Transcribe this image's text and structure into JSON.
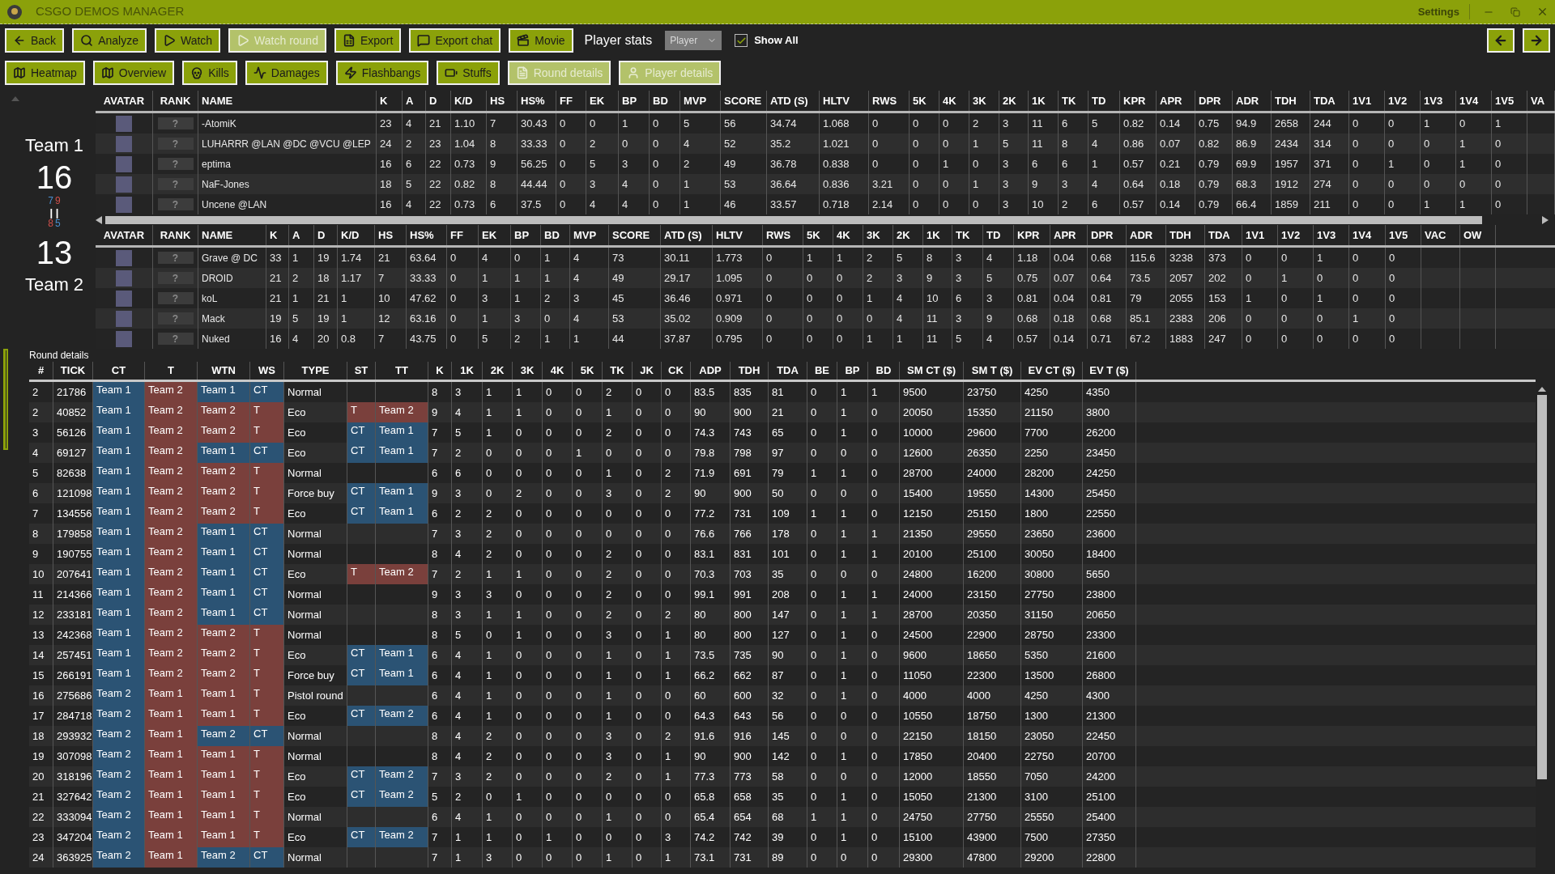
{
  "window": {
    "title": "CSGO DEMOS MANAGER",
    "settings": "Settings"
  },
  "toolbar_rows": [
    {
      "buttons": [
        {
          "label": "Back",
          "disabled": false
        },
        {
          "label": "Analyze",
          "disabled": false
        },
        {
          "label": "Watch",
          "disabled": false
        },
        {
          "label": "Watch round",
          "disabled": true
        },
        {
          "label": "Export",
          "disabled": false
        },
        {
          "label": "Export chat",
          "disabled": false
        },
        {
          "label": "Movie",
          "disabled": false
        }
      ]
    },
    {
      "buttons": [
        {
          "label": "Heatmap",
          "disabled": false
        },
        {
          "label": "Overview",
          "disabled": false
        },
        {
          "label": "Kills",
          "disabled": false
        },
        {
          "label": "Damages",
          "disabled": false
        },
        {
          "label": "Flashbangs",
          "disabled": false
        },
        {
          "label": "Stuffs",
          "disabled": false
        },
        {
          "label": "Round details",
          "disabled": true
        },
        {
          "label": "Player details",
          "disabled": true
        }
      ]
    }
  ],
  "player_stats": {
    "label": "Player stats",
    "dropdown": "Player",
    "show_all": {
      "label": "Show All",
      "checked": true
    }
  },
  "score": {
    "team1": {
      "name": "Team 1",
      "score": "16"
    },
    "halves_team1": [
      {
        "text": "7",
        "color": "#4a8fd0"
      },
      {
        "text": "9",
        "color": "#d0504c"
      }
    ],
    "separator": "| |",
    "halves_team2": [
      {
        "text": "8",
        "color": "#d0504c"
      },
      {
        "text": "5",
        "color": "#4a8fd0"
      }
    ],
    "team2": {
      "name": "Team 2",
      "score": "13"
    }
  },
  "player_tables": [
    {
      "columns": [
        "AVATAR",
        "RANK",
        "NAME",
        "K",
        "A",
        "D",
        "K/D",
        "HS",
        "HS%",
        "FF",
        "EK",
        "BP",
        "BD",
        "MVP",
        "SCORE",
        "ATD (S)",
        "HLTV",
        "RWS",
        "5K",
        "4K",
        "3K",
        "2K",
        "1K",
        "TK",
        "TD",
        "KPR",
        "APR",
        "DPR",
        "ADR",
        "TDH",
        "TDA",
        "1V1",
        "1V2",
        "1V3",
        "1V4",
        "1V5",
        "VA"
      ],
      "rows": [
        {
          "cells": [
            null,
            "?",
            "-AtomiK",
            "23",
            "4",
            "21",
            "1.10",
            "7",
            "30.43",
            "0",
            "0",
            "1",
            "0",
            "5",
            "56",
            "34.74",
            "1.068",
            "0",
            "0",
            "0",
            "2",
            "3",
            "11",
            "6",
            "5",
            "0.82",
            "0.14",
            "0.75",
            "94.9",
            "2658",
            "244",
            "0",
            "0",
            "1",
            "0",
            "1"
          ]
        },
        {
          "cells": [
            null,
            "?",
            "LUHARRR @LAN @DC @VCU @LEP",
            "24",
            "2",
            "23",
            "1.04",
            "8",
            "33.33",
            "0",
            "2",
            "0",
            "0",
            "4",
            "52",
            "35.2",
            "1.021",
            "0",
            "0",
            "0",
            "1",
            "5",
            "11",
            "8",
            "4",
            "0.86",
            "0.07",
            "0.82",
            "86.9",
            "2434",
            "314",
            "0",
            "0",
            "0",
            "1",
            "0"
          ]
        },
        {
          "cells": [
            null,
            "?",
            "eptima",
            "16",
            "6",
            "22",
            "0.73",
            "9",
            "56.25",
            "0",
            "5",
            "3",
            "0",
            "2",
            "49",
            "36.78",
            "0.838",
            "0",
            "0",
            "1",
            "0",
            "3",
            "6",
            "6",
            "1",
            "0.57",
            "0.21",
            "0.79",
            "69.9",
            "1957",
            "371",
            "0",
            "1",
            "0",
            "1",
            "0"
          ]
        },
        {
          "cells": [
            null,
            "?",
            "NaF-Jones",
            "18",
            "5",
            "22",
            "0.82",
            "8",
            "44.44",
            "0",
            "3",
            "4",
            "0",
            "1",
            "53",
            "36.64",
            "0.836",
            "3.21",
            "0",
            "0",
            "1",
            "3",
            "9",
            "3",
            "4",
            "0.64",
            "0.18",
            "0.79",
            "68.3",
            "1912",
            "274",
            "0",
            "0",
            "0",
            "0",
            "0"
          ]
        },
        {
          "cells": [
            null,
            "?",
            "Uncene @LAN",
            "16",
            "4",
            "22",
            "0.73",
            "6",
            "37.5",
            "0",
            "4",
            "4",
            "0",
            "1",
            "46",
            "33.57",
            "0.718",
            "2.14",
            "0",
            "0",
            "0",
            "3",
            "10",
            "2",
            "6",
            "0.57",
            "0.14",
            "0.79",
            "66.4",
            "1859",
            "211",
            "0",
            "0",
            "1",
            "1",
            "0"
          ]
        }
      ]
    },
    {
      "columns": [
        "AVATAR",
        "RANK",
        "NAME",
        "K",
        "A",
        "D",
        "K/D",
        "HS",
        "HS%",
        "FF",
        "EK",
        "BP",
        "BD",
        "MVP",
        "SCORE",
        "ATD (S)",
        "HLTV",
        "RWS",
        "5K",
        "4K",
        "3K",
        "2K",
        "1K",
        "TK",
        "TD",
        "KPR",
        "APR",
        "DPR",
        "ADR",
        "TDH",
        "TDA",
        "1V1",
        "1V2",
        "1V3",
        "1V4",
        "1V5",
        "VAC",
        "OW"
      ],
      "rows": [
        {
          "cells": [
            null,
            "?",
            "Grave @ DC",
            "33",
            "1",
            "19",
            "1.74",
            "21",
            "63.64",
            "0",
            "4",
            "0",
            "1",
            "4",
            "73",
            "30.11",
            "1.773",
            "0",
            "1",
            "1",
            "2",
            "5",
            "8",
            "3",
            "4",
            "1.18",
            "0.04",
            "0.68",
            "115.6",
            "3238",
            "373",
            "0",
            "0",
            "1",
            "0",
            "0"
          ]
        },
        {
          "cells": [
            null,
            "?",
            "DROID",
            "21",
            "2",
            "18",
            "1.17",
            "7",
            "33.33",
            "0",
            "1",
            "1",
            "1",
            "4",
            "49",
            "29.17",
            "1.095",
            "0",
            "0",
            "0",
            "2",
            "3",
            "9",
            "3",
            "5",
            "0.75",
            "0.07",
            "0.64",
            "73.5",
            "2057",
            "202",
            "0",
            "1",
            "0",
            "0",
            "0"
          ]
        },
        {
          "cells": [
            null,
            "?",
            "koL",
            "21",
            "1",
            "21",
            "1",
            "10",
            "47.62",
            "0",
            "3",
            "1",
            "2",
            "3",
            "45",
            "36.46",
            "0.971",
            "0",
            "0",
            "0",
            "1",
            "4",
            "10",
            "6",
            "3",
            "0.81",
            "0.04",
            "0.81",
            "79",
            "2055",
            "153",
            "1",
            "0",
            "1",
            "0",
            "0"
          ]
        },
        {
          "cells": [
            null,
            "?",
            "Mack",
            "19",
            "5",
            "19",
            "1",
            "12",
            "63.16",
            "0",
            "1",
            "3",
            "0",
            "4",
            "53",
            "35.02",
            "0.909",
            "0",
            "0",
            "0",
            "0",
            "4",
            "11",
            "3",
            "9",
            "0.68",
            "0.18",
            "0.68",
            "85.1",
            "2383",
            "206",
            "0",
            "0",
            "0",
            "1",
            "0"
          ]
        },
        {
          "cells": [
            null,
            "?",
            "Nuked",
            "16",
            "4",
            "20",
            "0.8",
            "7",
            "43.75",
            "0",
            "5",
            "2",
            "1",
            "1",
            "44",
            "37.87",
            "0.795",
            "0",
            "0",
            "0",
            "1",
            "1",
            "11",
            "5",
            "4",
            "0.57",
            "0.14",
            "0.71",
            "67.2",
            "1883",
            "247",
            "0",
            "0",
            "0",
            "0",
            "0"
          ]
        }
      ]
    }
  ],
  "round_details": {
    "title": "Round details",
    "columns": [
      "#",
      "TICK",
      "CT",
      "T",
      "WTN",
      "WS",
      "TYPE",
      "ST",
      "TT",
      "K",
      "1K",
      "2K",
      "3K",
      "4K",
      "5K",
      "TK",
      "JK",
      "CK",
      "ADP",
      "TDH",
      "TDA",
      "BE",
      "BP",
      "BD",
      "SM CT ($)",
      "SM T ($)",
      "EV CT ($)",
      "EV T ($)"
    ],
    "rows": [
      {
        "cells": [
          "2",
          "21786",
          {
            "t": "Team 1",
            "color": "#2b5374"
          },
          {
            "t": "Team 2",
            "color": "#7a403c"
          },
          {
            "t": "Team 1",
            "color": "#2b5374"
          },
          {
            "t": "CT",
            "color": "#2b5374"
          },
          "Normal",
          null,
          null,
          "8",
          "3",
          "1",
          "1",
          "0",
          "0",
          "2",
          "0",
          "0",
          "83.5",
          "835",
          "81",
          "0",
          "1",
          "1",
          "9500",
          "23750",
          "4250",
          "4350"
        ]
      },
      {
        "cells": [
          "2",
          "40852",
          {
            "t": "Team 1",
            "color": "#2b5374"
          },
          {
            "t": "Team 2",
            "color": "#7a403c"
          },
          {
            "t": "Team 2",
            "color": "#7a403c"
          },
          {
            "t": "T",
            "color": "#7a403c"
          },
          "Eco",
          {
            "t": "T",
            "color": "#7a403c"
          },
          {
            "t": "Team 2",
            "color": "#7a403c"
          },
          "9",
          "4",
          "1",
          "1",
          "0",
          "0",
          "1",
          "0",
          "0",
          "90",
          "900",
          "21",
          "0",
          "1",
          "0",
          "20050",
          "15350",
          "21150",
          "3800"
        ]
      },
      {
        "cells": [
          "3",
          "56126",
          {
            "t": "Team 1",
            "color": "#2b5374"
          },
          {
            "t": "Team 2",
            "color": "#7a403c"
          },
          {
            "t": "Team 2",
            "color": "#7a403c"
          },
          {
            "t": "T",
            "color": "#7a403c"
          },
          "Eco",
          {
            "t": "CT",
            "color": "#2b5374"
          },
          {
            "t": "Team 1",
            "color": "#2b5374"
          },
          "7",
          "5",
          "1",
          "0",
          "0",
          "0",
          "2",
          "0",
          "0",
          "74.3",
          "743",
          "65",
          "0",
          "1",
          "0",
          "10000",
          "29600",
          "7700",
          "26200"
        ]
      },
      {
        "cells": [
          "4",
          "69127",
          {
            "t": "Team 1",
            "color": "#2b5374"
          },
          {
            "t": "Team 2",
            "color": "#7a403c"
          },
          {
            "t": "Team 1",
            "color": "#2b5374"
          },
          {
            "t": "CT",
            "color": "#2b5374"
          },
          "Eco",
          {
            "t": "CT",
            "color": "#2b5374"
          },
          {
            "t": "Team 1",
            "color": "#2b5374"
          },
          "7",
          "2",
          "0",
          "0",
          "0",
          "1",
          "0",
          "0",
          "0",
          "79.8",
          "798",
          "97",
          "0",
          "0",
          "0",
          "12600",
          "26350",
          "2250",
          "23450"
        ]
      },
      {
        "cells": [
          "5",
          "82638",
          {
            "t": "Team 1",
            "color": "#2b5374"
          },
          {
            "t": "Team 2",
            "color": "#7a403c"
          },
          {
            "t": "Team 2",
            "color": "#7a403c"
          },
          {
            "t": "T",
            "color": "#7a403c"
          },
          "Normal",
          null,
          null,
          "6",
          "6",
          "0",
          "0",
          "0",
          "0",
          "1",
          "0",
          "2",
          "71.9",
          "691",
          "79",
          "1",
          "1",
          "0",
          "28700",
          "24000",
          "28200",
          "24250"
        ]
      },
      {
        "cells": [
          "6",
          "121098",
          {
            "t": "Team 1",
            "color": "#2b5374"
          },
          {
            "t": "Team 2",
            "color": "#7a403c"
          },
          {
            "t": "Team 2",
            "color": "#7a403c"
          },
          {
            "t": "T",
            "color": "#7a403c"
          },
          "Force buy",
          {
            "t": "CT",
            "color": "#2b5374"
          },
          {
            "t": "Team 1",
            "color": "#2b5374"
          },
          "9",
          "3",
          "0",
          "2",
          "0",
          "0",
          "3",
          "0",
          "2",
          "90",
          "900",
          "50",
          "0",
          "0",
          "0",
          "15400",
          "19550",
          "14300",
          "25450"
        ]
      },
      {
        "cells": [
          "7",
          "134556",
          {
            "t": "Team 1",
            "color": "#2b5374"
          },
          {
            "t": "Team 2",
            "color": "#7a403c"
          },
          {
            "t": "Team 2",
            "color": "#7a403c"
          },
          {
            "t": "T",
            "color": "#7a403c"
          },
          "Eco",
          {
            "t": "CT",
            "color": "#2b5374"
          },
          {
            "t": "Team 1",
            "color": "#2b5374"
          },
          "6",
          "2",
          "2",
          "0",
          "0",
          "0",
          "0",
          "0",
          "0",
          "77.2",
          "731",
          "109",
          "1",
          "1",
          "0",
          "12150",
          "25150",
          "1800",
          "22550"
        ]
      },
      {
        "cells": [
          "8",
          "179858",
          {
            "t": "Team 1",
            "color": "#2b5374"
          },
          {
            "t": "Team 2",
            "color": "#7a403c"
          },
          {
            "t": "Team 1",
            "color": "#2b5374"
          },
          {
            "t": "CT",
            "color": "#2b5374"
          },
          "Normal",
          null,
          null,
          "7",
          "3",
          "2",
          "0",
          "0",
          "0",
          "0",
          "0",
          "0",
          "76.6",
          "766",
          "178",
          "0",
          "1",
          "1",
          "21350",
          "29550",
          "23650",
          "23600"
        ]
      },
      {
        "cells": [
          "9",
          "190755",
          {
            "t": "Team 1",
            "color": "#2b5374"
          },
          {
            "t": "Team 2",
            "color": "#7a403c"
          },
          {
            "t": "Team 1",
            "color": "#2b5374"
          },
          {
            "t": "CT",
            "color": "#2b5374"
          },
          "Normal",
          null,
          null,
          "8",
          "4",
          "2",
          "0",
          "0",
          "0",
          "2",
          "0",
          "0",
          "83.1",
          "831",
          "101",
          "0",
          "1",
          "1",
          "20100",
          "25100",
          "30050",
          "18400"
        ]
      },
      {
        "cells": [
          "10",
          "207641",
          {
            "t": "Team 1",
            "color": "#2b5374"
          },
          {
            "t": "Team 2",
            "color": "#7a403c"
          },
          {
            "t": "Team 1",
            "color": "#2b5374"
          },
          {
            "t": "CT",
            "color": "#2b5374"
          },
          "Eco",
          {
            "t": "T",
            "color": "#7a403c"
          },
          {
            "t": "Team 2",
            "color": "#7a403c"
          },
          "7",
          "2",
          "1",
          "1",
          "0",
          "0",
          "2",
          "0",
          "0",
          "70.3",
          "703",
          "35",
          "0",
          "0",
          "0",
          "24800",
          "16200",
          "30800",
          "5650"
        ]
      },
      {
        "cells": [
          "11",
          "214366",
          {
            "t": "Team 1",
            "color": "#2b5374"
          },
          {
            "t": "Team 2",
            "color": "#7a403c"
          },
          {
            "t": "Team 1",
            "color": "#2b5374"
          },
          {
            "t": "CT",
            "color": "#2b5374"
          },
          "Normal",
          null,
          null,
          "9",
          "3",
          "3",
          "0",
          "0",
          "0",
          "2",
          "0",
          "0",
          "99.1",
          "991",
          "208",
          "0",
          "1",
          "1",
          "24000",
          "23150",
          "27750",
          "23800"
        ]
      },
      {
        "cells": [
          "12",
          "233181",
          {
            "t": "Team 1",
            "color": "#2b5374"
          },
          {
            "t": "Team 2",
            "color": "#7a403c"
          },
          {
            "t": "Team 1",
            "color": "#2b5374"
          },
          {
            "t": "CT",
            "color": "#2b5374"
          },
          "Normal",
          null,
          null,
          "8",
          "3",
          "1",
          "1",
          "0",
          "0",
          "2",
          "0",
          "2",
          "80",
          "800",
          "147",
          "0",
          "1",
          "1",
          "28700",
          "20350",
          "31150",
          "20650"
        ]
      },
      {
        "cells": [
          "13",
          "242368",
          {
            "t": "Team 1",
            "color": "#2b5374"
          },
          {
            "t": "Team 2",
            "color": "#7a403c"
          },
          {
            "t": "Team 2",
            "color": "#7a403c"
          },
          {
            "t": "T",
            "color": "#7a403c"
          },
          "Normal",
          null,
          null,
          "8",
          "5",
          "0",
          "1",
          "0",
          "0",
          "3",
          "0",
          "1",
          "80",
          "800",
          "127",
          "0",
          "1",
          "0",
          "24500",
          "22900",
          "28750",
          "23300"
        ]
      },
      {
        "cells": [
          "14",
          "257451",
          {
            "t": "Team 1",
            "color": "#2b5374"
          },
          {
            "t": "Team 2",
            "color": "#7a403c"
          },
          {
            "t": "Team 2",
            "color": "#7a403c"
          },
          {
            "t": "T",
            "color": "#7a403c"
          },
          "Eco",
          {
            "t": "CT",
            "color": "#2b5374"
          },
          {
            "t": "Team 1",
            "color": "#2b5374"
          },
          "6",
          "4",
          "1",
          "0",
          "0",
          "0",
          "1",
          "0",
          "1",
          "73.5",
          "735",
          "90",
          "0",
          "1",
          "0",
          "9600",
          "18650",
          "5350",
          "21600"
        ]
      },
      {
        "cells": [
          "15",
          "266191",
          {
            "t": "Team 1",
            "color": "#2b5374"
          },
          {
            "t": "Team 2",
            "color": "#7a403c"
          },
          {
            "t": "Team 2",
            "color": "#7a403c"
          },
          {
            "t": "T",
            "color": "#7a403c"
          },
          "Force buy",
          {
            "t": "CT",
            "color": "#2b5374"
          },
          {
            "t": "Team 1",
            "color": "#2b5374"
          },
          "6",
          "4",
          "1",
          "0",
          "0",
          "0",
          "1",
          "0",
          "1",
          "66.2",
          "662",
          "87",
          "0",
          "1",
          "0",
          "11050",
          "22300",
          "13500",
          "26800"
        ]
      },
      {
        "cells": [
          "16",
          "275686",
          {
            "t": "Team 2",
            "color": "#2b5374"
          },
          {
            "t": "Team 1",
            "color": "#7a403c"
          },
          {
            "t": "Team 1",
            "color": "#7a403c"
          },
          {
            "t": "T",
            "color": "#7a403c"
          },
          "Pistol round",
          null,
          null,
          "6",
          "4",
          "1",
          "0",
          "0",
          "0",
          "1",
          "0",
          "0",
          "60",
          "600",
          "32",
          "0",
          "1",
          "0",
          "4000",
          "4000",
          "4250",
          "4300"
        ]
      },
      {
        "cells": [
          "17",
          "284718",
          {
            "t": "Team 2",
            "color": "#2b5374"
          },
          {
            "t": "Team 1",
            "color": "#7a403c"
          },
          {
            "t": "Team 1",
            "color": "#7a403c"
          },
          {
            "t": "T",
            "color": "#7a403c"
          },
          "Eco",
          {
            "t": "CT",
            "color": "#2b5374"
          },
          {
            "t": "Team 2",
            "color": "#2b5374"
          },
          "6",
          "4",
          "1",
          "0",
          "0",
          "0",
          "1",
          "0",
          "0",
          "64.3",
          "643",
          "56",
          "0",
          "0",
          "0",
          "10550",
          "18750",
          "1300",
          "21300"
        ]
      },
      {
        "cells": [
          "18",
          "293932",
          {
            "t": "Team 2",
            "color": "#2b5374"
          },
          {
            "t": "Team 1",
            "color": "#7a403c"
          },
          {
            "t": "Team 2",
            "color": "#2b5374"
          },
          {
            "t": "CT",
            "color": "#2b5374"
          },
          "Normal",
          null,
          null,
          "8",
          "4",
          "2",
          "0",
          "0",
          "0",
          "3",
          "0",
          "2",
          "91.6",
          "916",
          "145",
          "0",
          "0",
          "0",
          "22150",
          "18150",
          "23050",
          "22450"
        ]
      },
      {
        "cells": [
          "19",
          "307098",
          {
            "t": "Team 2",
            "color": "#2b5374"
          },
          {
            "t": "Team 1",
            "color": "#7a403c"
          },
          {
            "t": "Team 1",
            "color": "#7a403c"
          },
          {
            "t": "T",
            "color": "#7a403c"
          },
          "Normal",
          null,
          null,
          "8",
          "4",
          "2",
          "0",
          "0",
          "0",
          "3",
          "0",
          "1",
          "90",
          "900",
          "142",
          "0",
          "1",
          "0",
          "17850",
          "20400",
          "22750",
          "20700"
        ]
      },
      {
        "cells": [
          "20",
          "318196",
          {
            "t": "Team 2",
            "color": "#2b5374"
          },
          {
            "t": "Team 1",
            "color": "#7a403c"
          },
          {
            "t": "Team 1",
            "color": "#7a403c"
          },
          {
            "t": "T",
            "color": "#7a403c"
          },
          "Eco",
          {
            "t": "CT",
            "color": "#2b5374"
          },
          {
            "t": "Team 2",
            "color": "#2b5374"
          },
          "7",
          "3",
          "2",
          "0",
          "0",
          "0",
          "2",
          "0",
          "1",
          "77.3",
          "773",
          "58",
          "0",
          "0",
          "0",
          "12000",
          "18550",
          "7050",
          "24200"
        ]
      },
      {
        "cells": [
          "21",
          "327642",
          {
            "t": "Team 2",
            "color": "#2b5374"
          },
          {
            "t": "Team 1",
            "color": "#7a403c"
          },
          {
            "t": "Team 1",
            "color": "#7a403c"
          },
          {
            "t": "T",
            "color": "#7a403c"
          },
          "Eco",
          {
            "t": "CT",
            "color": "#2b5374"
          },
          {
            "t": "Team 2",
            "color": "#2b5374"
          },
          "5",
          "2",
          "0",
          "1",
          "0",
          "0",
          "0",
          "0",
          "0",
          "65.8",
          "658",
          "35",
          "0",
          "1",
          "0",
          "15050",
          "21300",
          "3100",
          "25100"
        ]
      },
      {
        "cells": [
          "22",
          "333094",
          {
            "t": "Team 2",
            "color": "#2b5374"
          },
          {
            "t": "Team 1",
            "color": "#7a403c"
          },
          {
            "t": "Team 1",
            "color": "#7a403c"
          },
          {
            "t": "T",
            "color": "#7a403c"
          },
          "Normal",
          null,
          null,
          "6",
          "4",
          "1",
          "0",
          "0",
          "0",
          "1",
          "0",
          "0",
          "65.4",
          "654",
          "68",
          "1",
          "1",
          "0",
          "24750",
          "27750",
          "25550",
          "25400"
        ]
      },
      {
        "cells": [
          "23",
          "347204",
          {
            "t": "Team 2",
            "color": "#2b5374"
          },
          {
            "t": "Team 1",
            "color": "#7a403c"
          },
          {
            "t": "Team 1",
            "color": "#7a403c"
          },
          {
            "t": "T",
            "color": "#7a403c"
          },
          "Eco",
          {
            "t": "CT",
            "color": "#2b5374"
          },
          {
            "t": "Team 2",
            "color": "#2b5374"
          },
          "7",
          "1",
          "1",
          "0",
          "1",
          "0",
          "0",
          "0",
          "3",
          "74.2",
          "742",
          "39",
          "0",
          "1",
          "0",
          "15100",
          "43900",
          "7500",
          "27350"
        ]
      },
      {
        "cells": [
          "24",
          "363925",
          {
            "t": "Team 2",
            "color": "#2b5374"
          },
          {
            "t": "Team 1",
            "color": "#7a403c"
          },
          {
            "t": "Team 2",
            "color": "#2b5374"
          },
          {
            "t": "CT",
            "color": "#2b5374"
          },
          "Normal",
          null,
          null,
          "7",
          "1",
          "3",
          "0",
          "0",
          "0",
          "1",
          "0",
          "1",
          "73.1",
          "731",
          "89",
          "0",
          "0",
          "0",
          "29300",
          "47800",
          "29200",
          "22800"
        ]
      }
    ]
  }
}
